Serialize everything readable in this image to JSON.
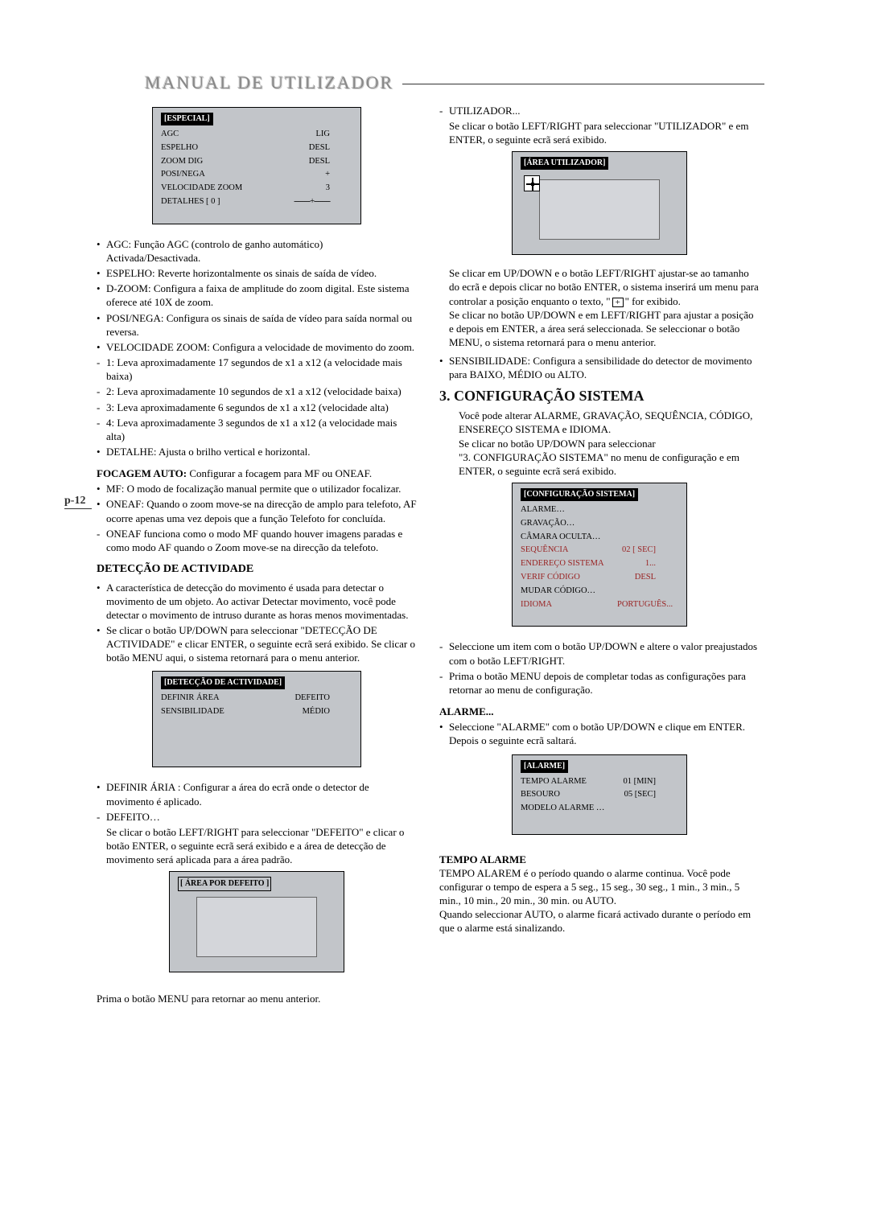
{
  "header": {
    "title": "MANUAL DE UTILIZADOR"
  },
  "page_number": "p-12",
  "left": {
    "osd_especial": {
      "title": "[ESPECIAL]",
      "rows": [
        {
          "l": "AGC",
          "v": "LIG"
        },
        {
          "l": "ESPELHO",
          "v": "DESL"
        },
        {
          "l": "ZOOM DIG",
          "v": "DESL"
        },
        {
          "l": "POSI/NEGA",
          "v": "+"
        },
        {
          "l": "VELOCIDADE ZOOM",
          "v": "3"
        },
        {
          "l": "DETALHES [ 0 ]",
          "v": "--------+--------"
        }
      ]
    },
    "bul1": "AGC: Função AGC (controlo de ganho automático) Activada/Desactivada.",
    "bul2": "ESPELHO: Reverte horizontalmente os sinais de saída de vídeo.",
    "bul3": "D-ZOOM: Configura a faixa de amplitude do zoom digital. Este sistema oferece até 10X de zoom.",
    "bul4": "POSI/NEGA: Configura os sinais de saída de vídeo para saída normal ou reversa.",
    "bul5": "VELOCIDADE ZOOM: Configura a velocidade de movimento do zoom.",
    "dash1": "1: Leva aproximadamente 17 segundos de x1 a x12 (a velocidade mais baixa)",
    "dash2": "2: Leva aproximadamente 10 segundos de x1 a x12 (velocidade baixa)",
    "dash3": "3: Leva aproximadamente 6 segundos de x1 a x12 (velocidade alta)",
    "dash4": "4: Leva aproximadamente 3 segundos de x1 a x12 (a velocidade mais alta)",
    "bul6": "DETALHE: Ajusta o brilho vertical e horizontal.",
    "focagem_head_bold": "FOCAGEM AUTO:",
    "focagem_head_rest": " Configurar a focagem para MF ou ONEAF.",
    "bul7": "MF: O modo de focalização manual permite que o utilizador focalizar.",
    "bul8": "ONEAF: Quando o zoom move-se na direcção de amplo para telefoto, AF ocorre apenas uma vez depois que a função Telefoto for concluída.",
    "dash5": "ONEAF funciona como o modo MF quando houver imagens paradas e como modo AF quando o Zoom move-se na direcção da telefoto.",
    "deteccao_head": "DETECÇÃO DE ACTIVIDADE",
    "bul9": "A característica de detecção do movimento é usada para detectar o movimento de um objeto. Ao activar Detectar movimento, você pode detectar o movimento de intruso durante as horas menos movimentadas.",
    "bul10": "Se clicar o botão UP/DOWN para seleccionar  \"DETECÇÃO DE ACTIVIDADE\" e clicar ENTER, o seguinte ecrã será exibido. Se clicar o botão MENU aqui, o sistema retornará para o menu anterior.",
    "osd_deteccao": {
      "title": "[DETECÇÃO DE ACTIVIDADE]",
      "rows": [
        {
          "l": "DEFINIR ÁREA",
          "v": "DEFEITO"
        },
        {
          "l": "SENSIBILIDADE",
          "v": "MÉDIO"
        }
      ]
    },
    "bul11": "DEFINIR ÁRIA : Configurar a área do ecrã onde o detector de movimento é aplicado.",
    "dash6l": "DEFEITO…",
    "dash6b": "Se clicar o botão LEFT/RIGHT para seleccionar \"DEFEITO\" e clicar o botão ENTER, o seguinte ecrã será exibido e a área de detecção de movimento será aplicada para a área padrão.",
    "osd_area_defeito": {
      "title": "[ ÁREA POR DEFEITO ]"
    },
    "footer": "Prima o botão MENU para retornar ao menu anterior."
  },
  "right": {
    "dash1l": "UTILIZADOR...",
    "dash1b": "Se clicar o botão LEFT/RIGHT para seleccionar \"UTILIZADOR\" e em ENTER, o seguinte ecrã será exibido.",
    "osd_area_util": {
      "title": "[ÁREA UTILIZADOR]"
    },
    "para1a": "Se clicar em UP/DOWN e o botão LEFT/RIGHT ajustar-se ao tamanho do ecrã e depois clicar no botão ENTER, o sistema inserirá um menu para controlar a posição enquanto o texto, \"",
    "para1b": "\" for exibido.",
    "para2": "Se clicar no botão UP/DOWN e em LEFT/RIGHT para ajustar a posição e depois em ENTER, a área será seleccionada. Se seleccionar o botão MENU, o sistema retornará para o menu anterior.",
    "bul_sens": "SENSIBILIDADE: Configura a sensibilidade do detector de movimento para BAIXO, MÉDIO ou ALTO.",
    "config_head": "3. CONFIGURAÇÃO SISTEMA",
    "config_p1": "Você pode alterar ALARME, GRAVAÇÃO, SEQUÊNCIA, CÓDIGO, ENSEREÇO SISTEMA e IDIOMA.",
    "config_p2": "Se clicar no botão UP/DOWN para seleccionar",
    "config_p3": "\"3. CONFIGURAÇÃO SISTEMA\" no menu de configuração  e em ENTER, o seguinte ecrã será exibido.",
    "osd_config": {
      "title": "[CONFIGURAÇÃO SISTEMA]",
      "lines_plain": [
        "ALARME…",
        "GRAVAÇÃO…",
        "CÂMARA OCULTA…"
      ],
      "rows": [
        {
          "l": "SEQUÊNCIA",
          "v": "02 [ SEC]"
        },
        {
          "l": "ENDEREÇO SISTEMA",
          "v": "1..."
        },
        {
          "l": "VERIF CÓDIGO",
          "v": "DESL"
        }
      ],
      "line_after": "MUDAR CÓDIGO…",
      "row_last": {
        "l": "IDIOMA",
        "v": "PORTUGUÊS..."
      }
    },
    "dash2": "Seleccione um item com o botão UP/DOWN e altere o valor preajustados com o botão LEFT/RIGHT.",
    "dash3": "Prima o botão MENU depois de completar todas as configurações para retornar ao menu de configuração.",
    "alarme_head": "ALARME...",
    "bul_alarme": "Seleccione \"ALARME\" com o botão UP/DOWN e clique em ENTER. Depois o seguinte ecrã saltará.",
    "osd_alarme": {
      "title": "[ALARME]",
      "rows": [
        {
          "l": "TEMPO ALARME",
          "v": "01 [MIN]"
        },
        {
          "l": "BESOURO",
          "v": "05 [SEC]"
        }
      ],
      "line_after": "MODELO ALARME  …"
    },
    "tempo_head": "TEMPO ALARME",
    "tempo_p1": "TEMPO ALAREM é o período quando o alarme continua. Você pode configurar o tempo de espera a 5 seg., 15 seg.,  30 seg., 1 min., 3 min., 5 min., 10 min., 20 min., 30 min. ou AUTO.",
    "tempo_p2": "Quando seleccionar AUTO, o alarme ficará activado durante o período em que o alarme está sinalizando."
  }
}
